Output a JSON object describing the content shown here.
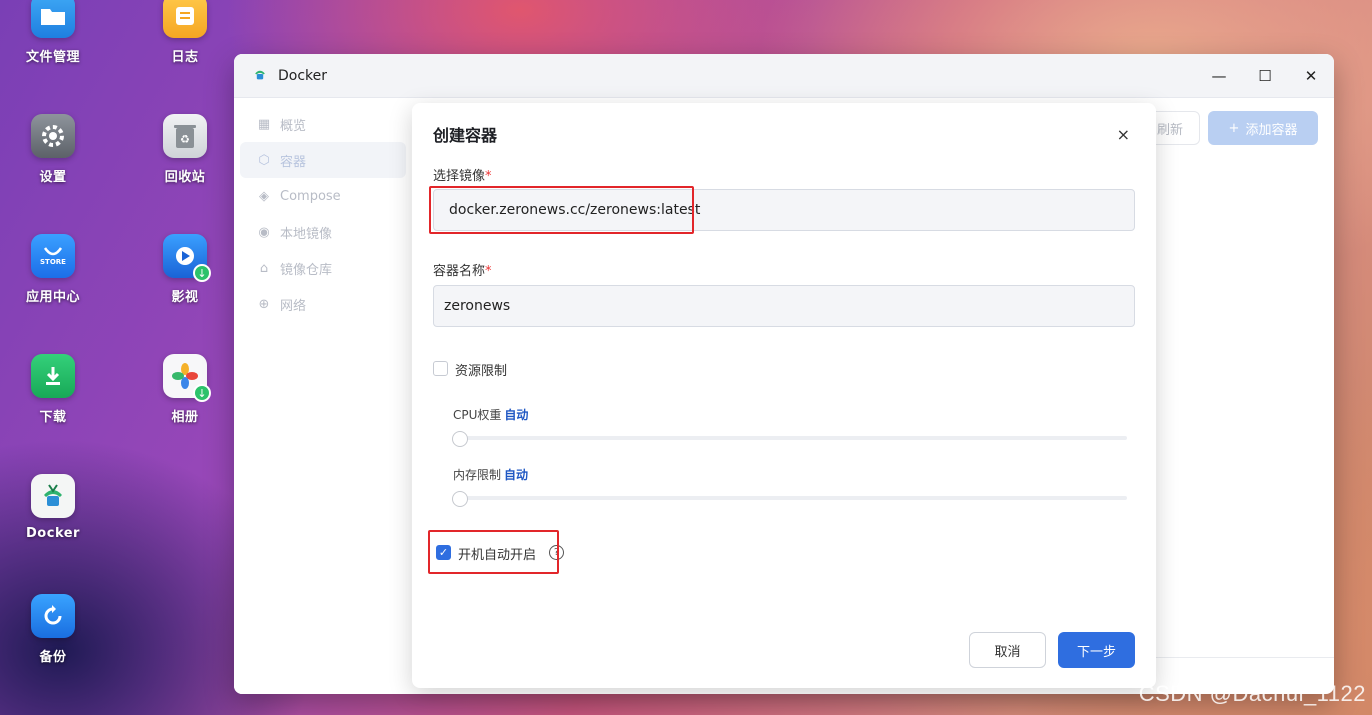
{
  "desktop": {
    "icons": [
      {
        "label": "文件管理",
        "icon": "folder-icon"
      },
      {
        "label": "日志",
        "icon": "notes-icon"
      },
      {
        "label": "设置",
        "icon": "gear-icon"
      },
      {
        "label": "回收站",
        "icon": "recycle-bin-icon"
      },
      {
        "label": "应用中心",
        "icon": "store-icon",
        "tile_text": "STORE"
      },
      {
        "label": "影视",
        "icon": "video-icon"
      },
      {
        "label": "下载",
        "icon": "download-icon"
      },
      {
        "label": "相册",
        "icon": "photos-icon"
      },
      {
        "label": "Docker",
        "icon": "docker-icon"
      },
      {
        "label": "备份",
        "icon": "backup-icon"
      }
    ]
  },
  "window": {
    "title": "Docker",
    "controls": {
      "minimize": "—",
      "maximize": "☐",
      "close": "✕"
    },
    "sidebar": [
      {
        "label": "概览",
        "icon": "grid-icon"
      },
      {
        "label": "容器",
        "icon": "cube-icon"
      },
      {
        "label": "Compose",
        "icon": "layers-icon"
      },
      {
        "label": "本地镜像",
        "icon": "eye-icon"
      },
      {
        "label": "镜像仓库",
        "icon": "home-icon"
      },
      {
        "label": "网络",
        "icon": "globe-icon"
      }
    ],
    "active_sidebar": "容器",
    "actions": {
      "refresh": "刷新",
      "add_container": "添加容器",
      "add_prefix": "+"
    }
  },
  "modal": {
    "title": "创建容器",
    "close": "×",
    "image_label": "选择镜像",
    "image_value": "docker.zeronews.cc/zeronews:latest",
    "name_label": "容器名称",
    "name_value": "zeronews",
    "required_mark": "*",
    "resource_limit": {
      "label": "资源限制",
      "checked": false
    },
    "cpu": {
      "label": "CPU权重",
      "value": "自动"
    },
    "memory": {
      "label": "内存限制",
      "value": "自动"
    },
    "autostart": {
      "label": "开机自动开启",
      "checked": true,
      "help": "?"
    },
    "cancel": "取消",
    "next": "下一步"
  },
  "watermark": "CSDN @Dachui_1122",
  "colors": {
    "primary": "#2f6ee0",
    "highlight_box": "#e2262a",
    "auto_text": "#1f57c3"
  }
}
